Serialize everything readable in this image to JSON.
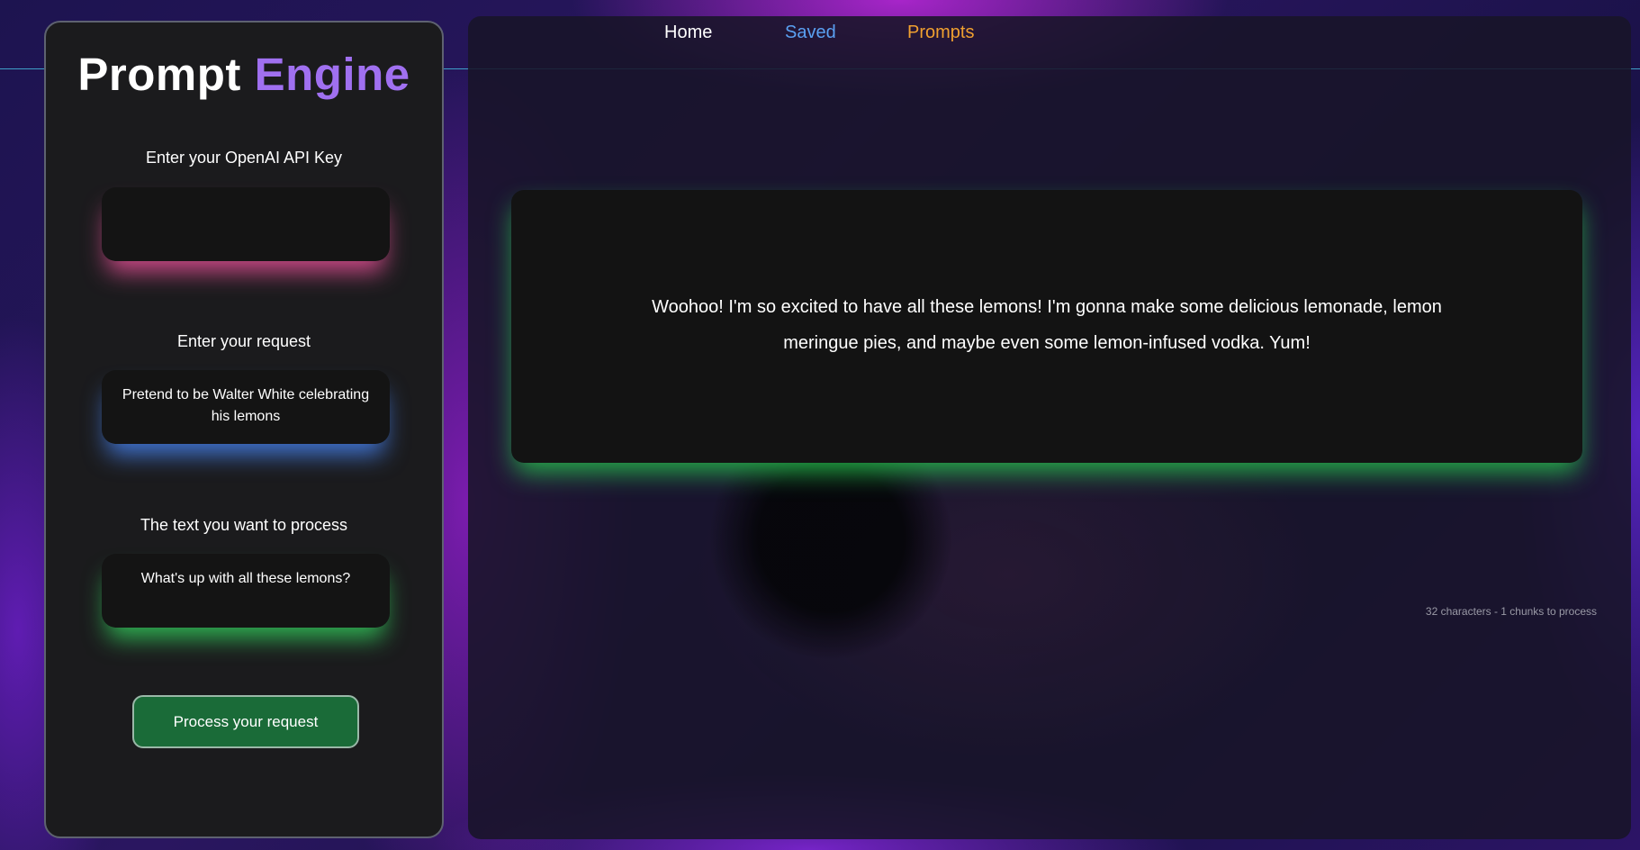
{
  "nav": {
    "home_label": "Home",
    "saved_label": "Saved",
    "prompts_label": "Prompts"
  },
  "sidebar": {
    "logo_part1": "Prompt",
    "logo_part2": "Engine",
    "api_key": {
      "label": "Enter your OpenAI API Key",
      "value": ""
    },
    "request": {
      "label": "Enter your request",
      "value": "Pretend to be Walter White celebrating his lemons"
    },
    "text_to_process": {
      "label": "The text you want to process",
      "value": "What's up with all these lemons?"
    },
    "process_button_label": "Process your request"
  },
  "main": {
    "output_text": "Woohoo! I'm so excited to have all these lemons! I'm gonna make some delicious lemonade, lemon meringue pies, and maybe even some lemon-infused vodka. Yum!",
    "chunk_info": "32 characters - 1 chunks to process"
  },
  "colors": {
    "accent_purple": "#a070f0",
    "nav_saved": "#5aa0f2",
    "nav_prompts": "#f0a030",
    "glow_pink": "#e65096",
    "glow_blue": "#4682f0",
    "glow_green": "#32c85a",
    "button_green": "#1a6b38"
  }
}
